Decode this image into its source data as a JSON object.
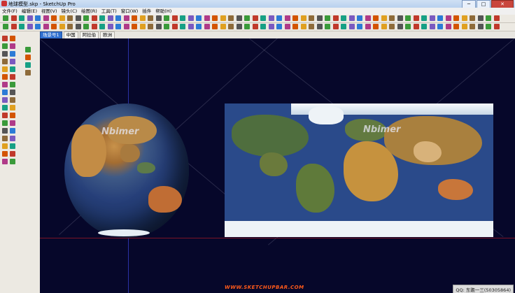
{
  "window": {
    "title": "地球模型.skp - SketchUp Pro",
    "minimize": "─",
    "maximize": "□",
    "close": "✕"
  },
  "menu": [
    "文件(F)",
    "编辑(E)",
    "视图(V)",
    "镜头(C)",
    "绘图(R)",
    "工具(T)",
    "窗口(W)",
    "插件",
    "帮助(H)"
  ],
  "scenes": [
    "场景号1",
    "中国",
    "阿拉伯",
    "欧洲"
  ],
  "viewport": {
    "watermark_left": "Nbimer",
    "watermark_right": "Nbimer",
    "bottom_logo": "WWW.SKETCHUPBAR.COM",
    "qq_badge": "QQ: 东瞻一三(50305864)"
  },
  "colors": {
    "viewport_bg": "#06072a",
    "active_scene": "#2f6fd0",
    "ocean": "#2a4a8a",
    "land": "#b07a3a",
    "vegetation": "#3f6a3a",
    "ice": "#eef3f7"
  }
}
